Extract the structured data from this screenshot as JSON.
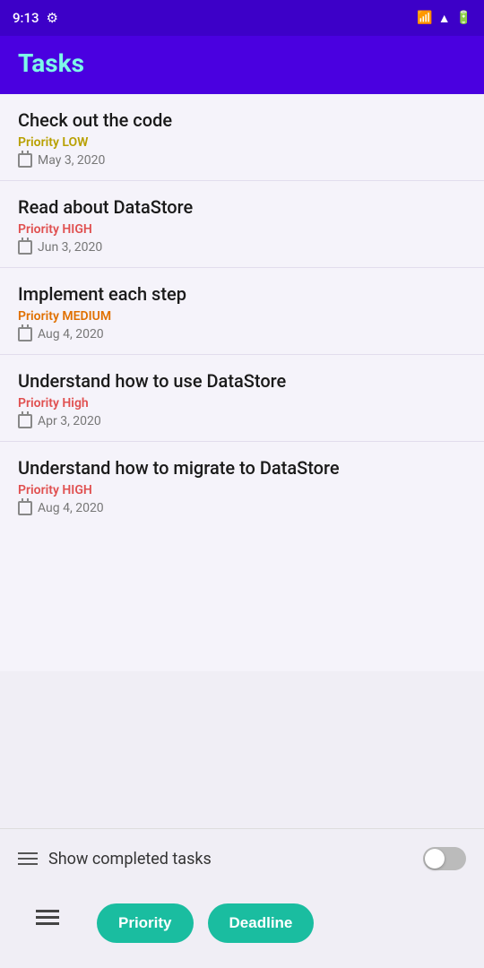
{
  "statusBar": {
    "time": "9:13",
    "settingsIcon": "gear-icon",
    "signalIcon": "signal-icon",
    "wifiIcon": "wifi-icon",
    "batteryIcon": "battery-icon"
  },
  "header": {
    "title": "Tasks"
  },
  "tasks": [
    {
      "id": 1,
      "title": "Check out the code",
      "priorityLabel": "Priority LOW",
      "priorityClass": "priority-low",
      "date": "May 3, 2020"
    },
    {
      "id": 2,
      "title": "Read about DataStore",
      "priorityLabel": "Priority HIGH",
      "priorityClass": "priority-high",
      "date": "Jun 3, 2020"
    },
    {
      "id": 3,
      "title": "Implement each step",
      "priorityLabel": "Priority MEDIUM",
      "priorityClass": "priority-medium",
      "date": "Aug 4, 2020"
    },
    {
      "id": 4,
      "title": "Understand how to use DataStore",
      "priorityLabel": "Priority High",
      "priorityClass": "priority-high",
      "date": "Apr 3, 2020"
    },
    {
      "id": 5,
      "title": "Understand how to migrate to DataStore",
      "priorityLabel": "Priority HIGH",
      "priorityClass": "priority-high",
      "date": "Aug 4, 2020"
    }
  ],
  "showCompleted": {
    "label": "Show completed tasks",
    "toggled": false
  },
  "bottomBar": {
    "priorityBtn": "Priority",
    "deadlineBtn": "Deadline"
  }
}
